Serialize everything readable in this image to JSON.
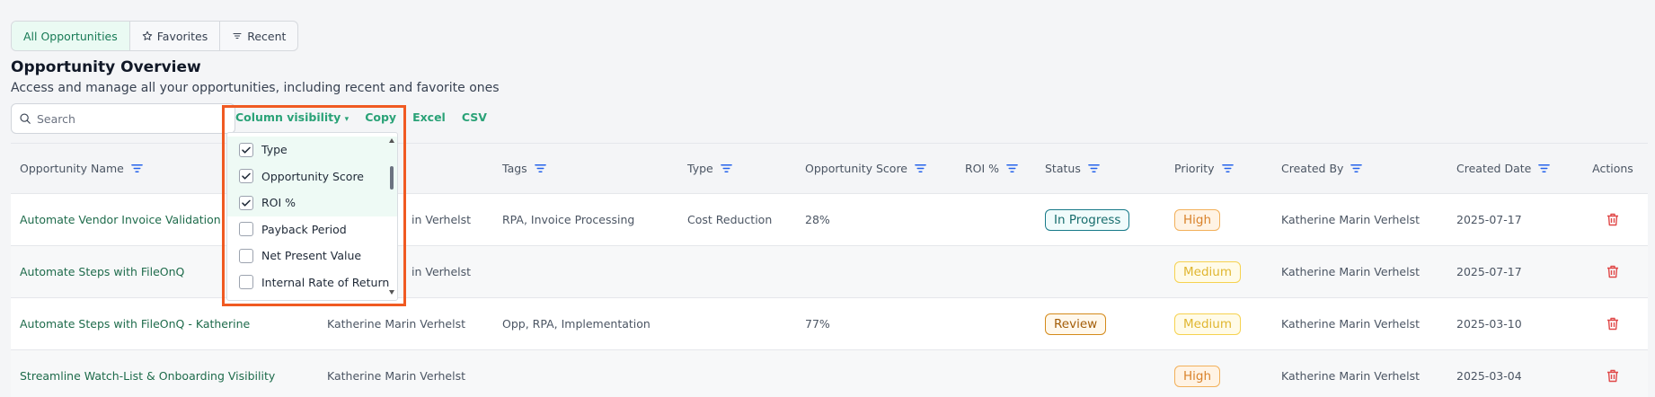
{
  "tabs": [
    {
      "label": "All Opportunities",
      "icon": "none"
    },
    {
      "label": "Favorites",
      "icon": "star-icon"
    },
    {
      "label": "Recent",
      "icon": "sort-icon"
    }
  ],
  "header": {
    "title": "Opportunity Overview",
    "subtitle": "Access and manage all your opportunities, including recent and favorite ones"
  },
  "search": {
    "placeholder": "Search",
    "value": ""
  },
  "toolbar": {
    "column_visibility_label": "Column visibility",
    "copy_label": "Copy",
    "excel_label": "Excel",
    "csv_label": "CSV"
  },
  "table": {
    "columns": [
      "Opportunity Name",
      "",
      "Tags",
      "Type",
      "Opportunity Score",
      "ROI %",
      "Status",
      "Priority",
      "Created By",
      "Created Date",
      "Actions"
    ],
    "rows": [
      {
        "name": "Automate Vendor Invoice Validation",
        "owner": "in Verhelst",
        "tags": "RPA, Invoice Processing",
        "type": "Cost Reduction",
        "score": "28%",
        "roi": "",
        "status": "In Progress",
        "priority": "High",
        "created_by": "Katherine Marin Verhelst",
        "created_date": "2025-07-17"
      },
      {
        "name": "Automate Steps with FileOnQ",
        "owner": "in Verhelst",
        "tags": "",
        "type": "",
        "score": "",
        "roi": "",
        "status": "",
        "priority": "Medium",
        "created_by": "Katherine Marin Verhelst",
        "created_date": "2025-07-17"
      },
      {
        "name": "Automate Steps with FileOnQ - Katherine",
        "owner": "Katherine Marin Verhelst",
        "tags": "Opp, RPA, Implementation",
        "type": "",
        "score": "77%",
        "roi": "",
        "status": "Review",
        "priority": "Medium",
        "created_by": "Katherine Marin Verhelst",
        "created_date": "2025-03-10"
      },
      {
        "name": "Streamline Watch-List & Onboarding Visibility",
        "owner": "Katherine Marin Verhelst",
        "tags": "",
        "type": "",
        "score": "",
        "roi": "",
        "status": "",
        "priority": "High",
        "created_by": "Katherine Marin Verhelst",
        "created_date": "2025-03-04"
      }
    ]
  },
  "column_menu": {
    "items": [
      {
        "label": "Type",
        "checked": true
      },
      {
        "label": "Opportunity Score",
        "checked": true
      },
      {
        "label": "ROI %",
        "checked": true
      },
      {
        "label": "Payback Period",
        "checked": false
      },
      {
        "label": "Net Present Value",
        "checked": false
      },
      {
        "label": "Internal Rate of Return",
        "checked": false
      }
    ]
  },
  "colors": {
    "accent": "#2aa277",
    "link": "#1e6b4b",
    "highlight_frame": "#f05a22",
    "delete": "#e04848"
  }
}
